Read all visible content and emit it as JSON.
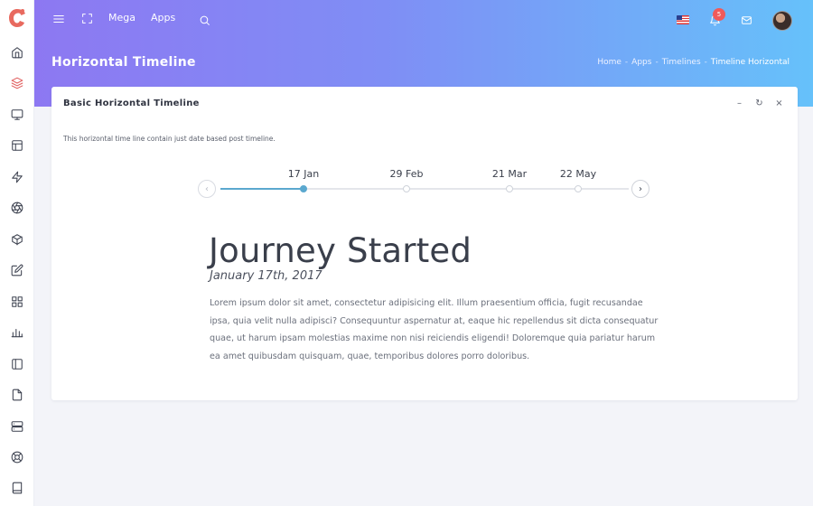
{
  "sidebar": {
    "items": [
      {
        "icon": "home-icon",
        "active": false
      },
      {
        "icon": "layers-icon",
        "active": true
      },
      {
        "icon": "monitor-icon",
        "active": false
      },
      {
        "icon": "layout-icon",
        "active": false
      },
      {
        "icon": "zap-icon",
        "active": false
      },
      {
        "icon": "aperture-icon",
        "active": false
      },
      {
        "icon": "box-icon",
        "active": false
      },
      {
        "icon": "edit-icon",
        "active": false
      },
      {
        "icon": "grid-icon",
        "active": false
      },
      {
        "icon": "bar-chart-icon",
        "active": false
      },
      {
        "icon": "sidebar-icon",
        "active": false
      },
      {
        "icon": "file-icon",
        "active": false
      },
      {
        "icon": "server-icon",
        "active": false
      },
      {
        "icon": "life-buoy-icon",
        "active": false
      },
      {
        "icon": "book-icon",
        "active": false
      }
    ]
  },
  "topbar": {
    "links": [
      "Mega",
      "Apps"
    ],
    "notification_count": "5"
  },
  "page": {
    "title": "Horizontal Timeline",
    "breadcrumb": [
      "Home",
      "Apps",
      "Timelines",
      "Timeline Horizontal"
    ]
  },
  "card": {
    "title": "Basic Horizontal Timeline",
    "tools": [
      "–",
      "↻",
      "×"
    ],
    "description": "This horizontal time line contain just date based post timeline."
  },
  "timeline": {
    "dates": [
      "17 Jan",
      "29 Feb",
      "21 Mar",
      "22 May"
    ],
    "selected": "17 Jan",
    "event": {
      "title": "Journey Started",
      "date": "January 17th, 2017",
      "body": "Lorem ipsum dolor sit amet, consectetur adipisicing elit. Illum praesentium officia, fugit recusandae ipsa, quia velit nulla adipisci? Consequuntur aspernatur at, eaque hic repellendus sit dicta consequatur quae, ut harum ipsam molestias maxime non nisi reiciendis eligendi! Doloremque quia pariatur harum ea amet quibusdam quisquam, quae, temporibus dolores porro doloribus."
    }
  },
  "colors": {
    "gradient_start": "#8d78f2",
    "gradient_end": "#66c1fa",
    "accent": "#5ba8cf",
    "logo": "#e05c5c",
    "badge": "#f05a5a"
  }
}
